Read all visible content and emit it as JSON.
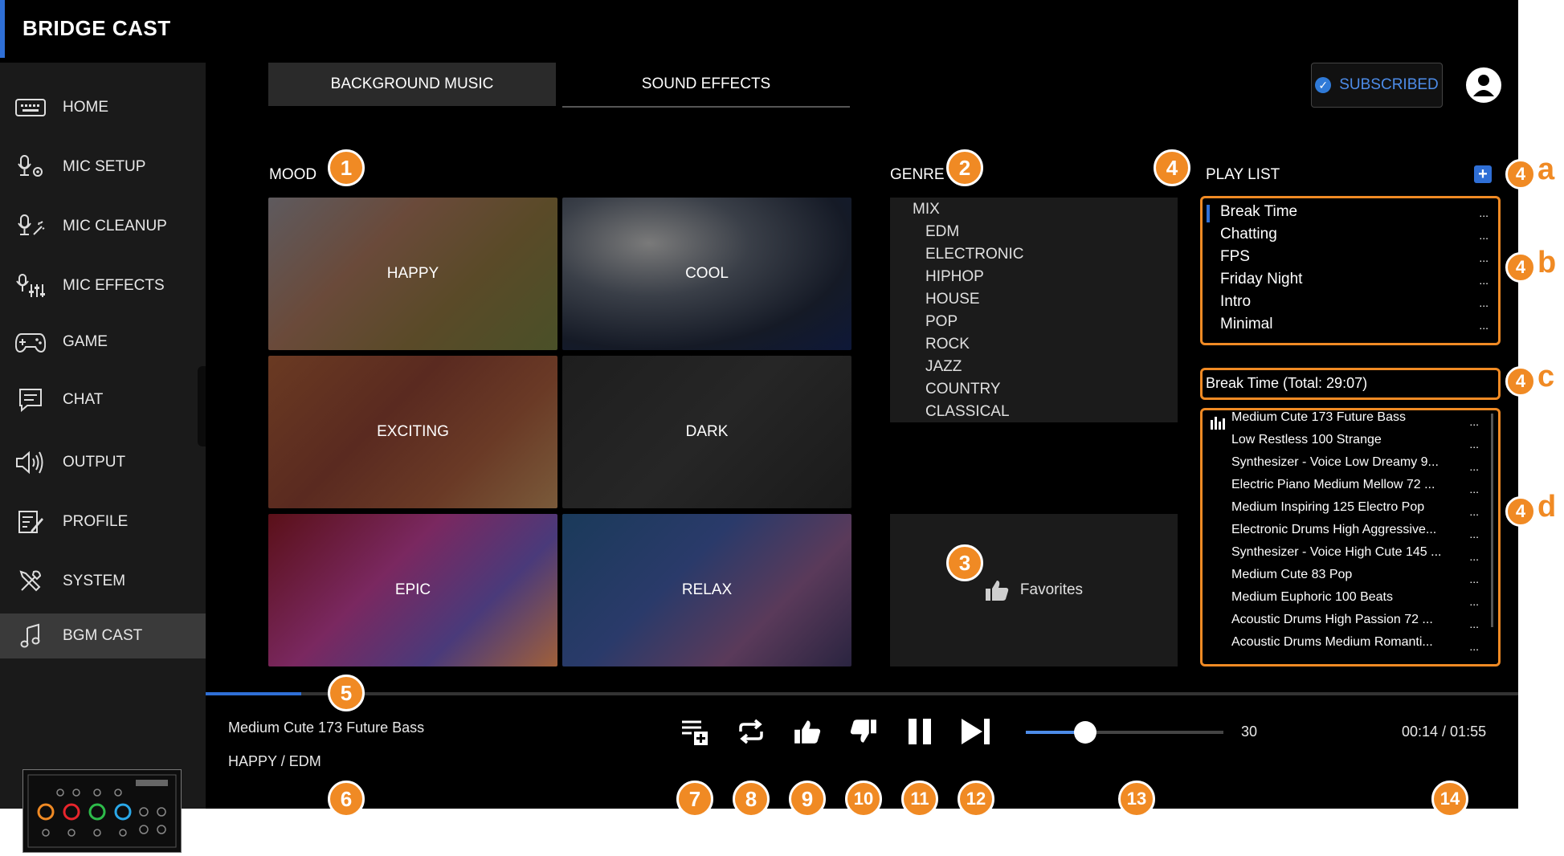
{
  "app": {
    "title": "BRIDGE CAST"
  },
  "sidebar": {
    "items": [
      {
        "label": "HOME",
        "icon": "keyboard-icon"
      },
      {
        "label": "MIC SETUP",
        "icon": "mic-gear-icon"
      },
      {
        "label": "MIC CLEANUP",
        "icon": "mic-sparkle-icon"
      },
      {
        "label": "MIC EFFECTS",
        "icon": "mic-sliders-icon"
      },
      {
        "label": "GAME",
        "icon": "gamepad-icon"
      },
      {
        "label": "CHAT",
        "icon": "chat-icon"
      },
      {
        "label": "OUTPUT",
        "icon": "speaker-icon"
      },
      {
        "label": "PROFILE",
        "icon": "profile-edit-icon"
      },
      {
        "label": "SYSTEM",
        "icon": "tools-icon"
      },
      {
        "label": "BGM CAST",
        "icon": "music-note-icon",
        "active": true
      }
    ]
  },
  "tabs": [
    {
      "label": "BACKGROUND MUSIC",
      "active": true
    },
    {
      "label": "SOUND EFFECTS",
      "active": false
    }
  ],
  "header": {
    "subscribed_label": "SUBSCRIBED"
  },
  "mood": {
    "label": "MOOD",
    "tiles": [
      "HAPPY",
      "COOL",
      "EXCITING",
      "DARK",
      "EPIC",
      "RELAX"
    ]
  },
  "genre": {
    "label": "GENRE",
    "items": [
      "MIX",
      "EDM",
      "ELECTRONIC",
      "HIPHOP",
      "HOUSE",
      "POP",
      "ROCK",
      "JAZZ",
      "COUNTRY",
      "CLASSICAL"
    ]
  },
  "favorites": {
    "label": "Favorites"
  },
  "playlist": {
    "label": "PLAY LIST",
    "more_label": "...",
    "items": [
      "Break Time",
      "Chatting",
      "FPS",
      "Friday Night",
      "Intro",
      "Minimal"
    ],
    "selected_title": "Break Time (Total: 29:07)",
    "tracks": [
      "Medium Cute 173 Future Bass",
      "Low Restless 100 Strange",
      "Synthesizer - Voice Low Dreamy 9...",
      "Electric Piano Medium Mellow 72 ...",
      "Medium Inspiring 125 Electro Pop",
      "Electronic Drums High Aggressive...",
      "Synthesizer - Voice High Cute 145 ...",
      "Medium Cute 83 Pop",
      "Medium Euphoric 100 Beats",
      "Acoustic Drums High Passion 72 ...",
      "Acoustic Drums Medium Romanti..."
    ]
  },
  "player": {
    "track_title": "Medium Cute 173 Future Bass",
    "track_category": "HAPPY / EDM",
    "progress_fraction": 0.073,
    "volume": 30,
    "volume_label": "30",
    "time": "00:14 / 01:55"
  },
  "callouts": {
    "mood": "1",
    "genre": "2",
    "favorites": "3",
    "playlist": "4",
    "progress": "5",
    "track_info": "6",
    "add_to_playlist": "7",
    "repeat": "8",
    "like": "9",
    "dislike": "10",
    "pause": "11",
    "next": "12",
    "volume": "13",
    "time": "14",
    "letters": [
      "a",
      "b",
      "c",
      "d"
    ]
  },
  "colors": {
    "accent": "#2f6fd6",
    "callout": "#f08a24",
    "background": "#000000",
    "sidebar": "#1a1a1a"
  }
}
